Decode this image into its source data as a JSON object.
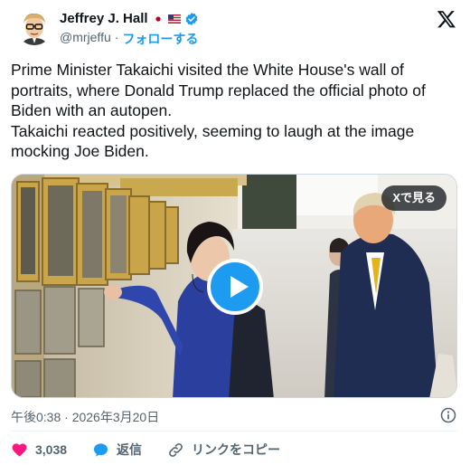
{
  "author": {
    "display_name": "Jeffrey J. Hall",
    "handle": "@mrjeffu",
    "separator": "·",
    "follow_label": "フォローする"
  },
  "tweet": {
    "text": "Prime Minister Takaichi visited the White House's wall of portraits, where Donald Trump replaced the official photo of Biden with an autopen.\nTakaichi reacted positively, seeming to laugh at the image mocking Joe Biden."
  },
  "media": {
    "view_on_x_label": "Xで見る"
  },
  "meta": {
    "timestamp": "午後0:38 · 2026年3月20日"
  },
  "actions": {
    "like_count": "3,038",
    "reply_label": "返信",
    "copy_link_label": "リンクをコピー"
  },
  "colors": {
    "accent": "#1d9bf0",
    "like": "#f91880",
    "secondary_text": "#536471"
  }
}
